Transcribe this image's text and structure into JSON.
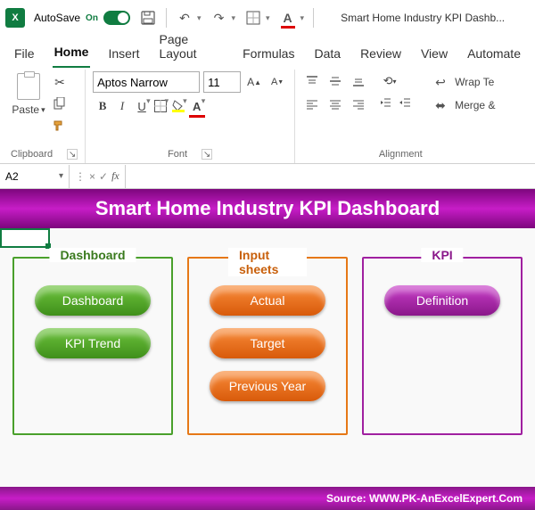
{
  "titlebar": {
    "autosave_label": "AutoSave",
    "autosave_state": "On",
    "doc_title": "Smart Home Industry KPI Dashb..."
  },
  "tabs": {
    "file": "File",
    "home": "Home",
    "insert": "Insert",
    "pagelayout": "Page Layout",
    "formulas": "Formulas",
    "data": "Data",
    "review": "Review",
    "view": "View",
    "automate": "Automate"
  },
  "ribbon": {
    "clipboard": {
      "label": "Clipboard",
      "paste": "Paste"
    },
    "font": {
      "label": "Font",
      "name": "Aptos Narrow",
      "size": "11"
    },
    "alignment": {
      "label": "Alignment",
      "wrap": "Wrap Te",
      "merge": "Merge &"
    }
  },
  "formulabar": {
    "cellref": "A2",
    "value": ""
  },
  "worksheet": {
    "banner": "Smart Home Industry KPI Dashboard",
    "panels": {
      "dashboard": {
        "title": "Dashboard",
        "buttons": [
          "Dashboard",
          "KPI Trend"
        ]
      },
      "inputs": {
        "title": "Input sheets",
        "buttons": [
          "Actual",
          "Target",
          "Previous Year"
        ]
      },
      "kpi": {
        "title": "KPI",
        "buttons": [
          "Definition"
        ]
      }
    },
    "footer": "Source: WWW.PK-AnExcelExpert.Com"
  }
}
